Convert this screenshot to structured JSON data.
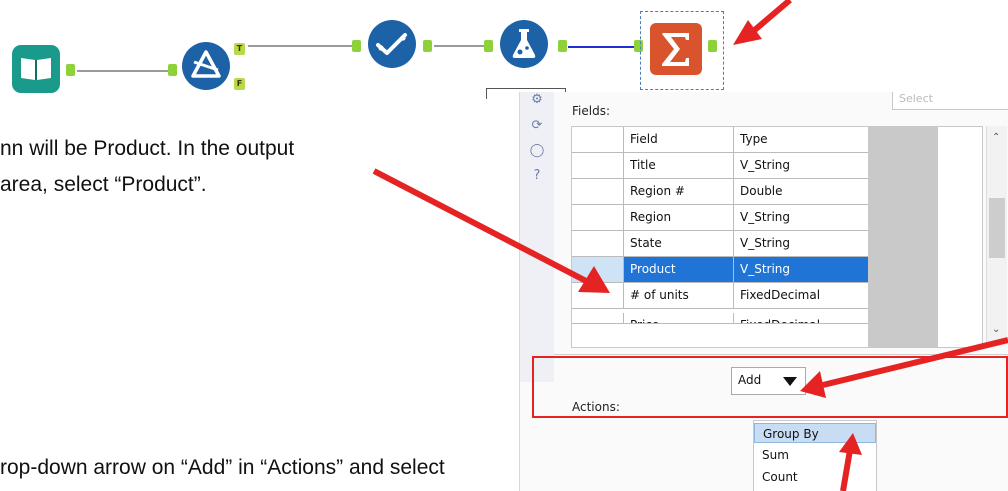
{
  "workflow": {
    "tools": [
      {
        "name": "input-data-tool",
        "icon": "book-icon",
        "color": "#1a9a8a"
      },
      {
        "name": "filter-tool",
        "icon": "filter-delta-icon",
        "color": "#1d62a6"
      },
      {
        "name": "select-tool",
        "icon": "checkmark-icon",
        "color": "#1d62a6"
      },
      {
        "name": "formula-tool",
        "icon": "flask-icon",
        "color": "#1d62a6"
      },
      {
        "name": "summarize-tool",
        "icon": "sigma-icon",
        "color": "#d9532c"
      }
    ],
    "filter_true_label": "T",
    "filter_false_label": "F"
  },
  "captions": {
    "line1": "nn will be Product. In the output",
    "line2": "area, select “Product”.",
    "line3": "rop-down arrow on “Add” in “Actions” and select"
  },
  "dialog": {
    "select_label": "Select",
    "fields_label": "Fields:",
    "columns": [
      "Field",
      "Type"
    ],
    "rows": [
      {
        "field": "Title",
        "type": "V_String",
        "selected": false
      },
      {
        "field": "Region #",
        "type": "Double",
        "selected": false
      },
      {
        "field": "Region",
        "type": "V_String",
        "selected": false
      },
      {
        "field": "State",
        "type": "V_String",
        "selected": false
      },
      {
        "field": "Product",
        "type": "V_String",
        "selected": true
      },
      {
        "field": "# of units",
        "type": "FixedDecimal",
        "selected": false
      },
      {
        "field": "Price",
        "type": "FixedDecimal",
        "selected": false
      }
    ],
    "actions_label": "Actions:",
    "add_label": "Add",
    "menu_items": [
      "Group By",
      "Sum",
      "Count"
    ]
  },
  "colors": {
    "annotation_red": "#e52323",
    "selection_blue": "#1f74d6",
    "connector_blue": "#1f2fd6"
  }
}
